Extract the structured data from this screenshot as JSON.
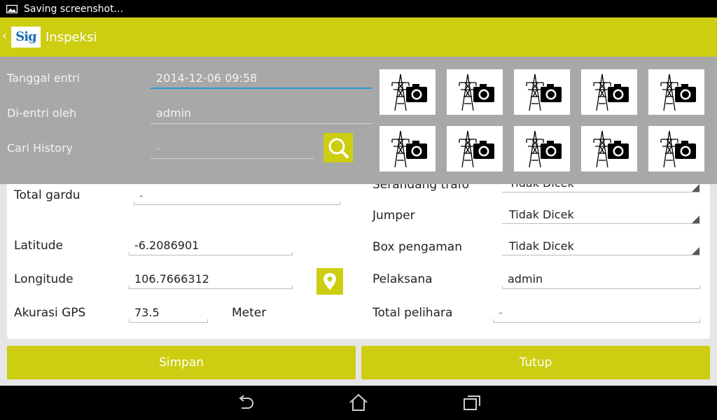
{
  "status_bar": {
    "notification": "Saving screenshot..."
  },
  "app_bar": {
    "back": "‹",
    "logo_text": "Sig",
    "title": "Inspeksi"
  },
  "header_fields": {
    "tanggal_label": "Tanggal entri",
    "tanggal_value": "2014-12-06 09:58",
    "dientri_label": "Di-entri oleh",
    "dientri_value": "admin",
    "cari_label": "Cari History",
    "cari_value": "-"
  },
  "photo_grid": {
    "rows": 2,
    "columns": 5,
    "icon": "tower-camera-icon"
  },
  "form": {
    "serandang_label": "Serandang trafo",
    "serandang_value": "Tidak Dicek",
    "total_gardu_label": "Total gardu",
    "total_gardu_value": "-",
    "jumper_label": "Jumper",
    "jumper_value": "Tidak Dicek",
    "latitude_label": "Latitude",
    "latitude_value": "-6.2086901",
    "box_label": "Box pengaman",
    "box_value": "Tidak Dicek",
    "longitude_label": "Longitude",
    "longitude_value": "106.7666312",
    "pelaksana_label": "Pelaksana",
    "pelaksana_value": "admin",
    "akurasi_label": "Akurasi GPS",
    "akurasi_value": "73.5",
    "akurasi_unit": "Meter",
    "total_pelihara_label": "Total pelihara",
    "total_pelihara_value": "-"
  },
  "buttons": {
    "save": "Simpan",
    "close": "Tutup"
  },
  "colors": {
    "accent": "#cdcd12",
    "overlay": "#a8a8a8",
    "focus_line": "#2a9bd6"
  }
}
